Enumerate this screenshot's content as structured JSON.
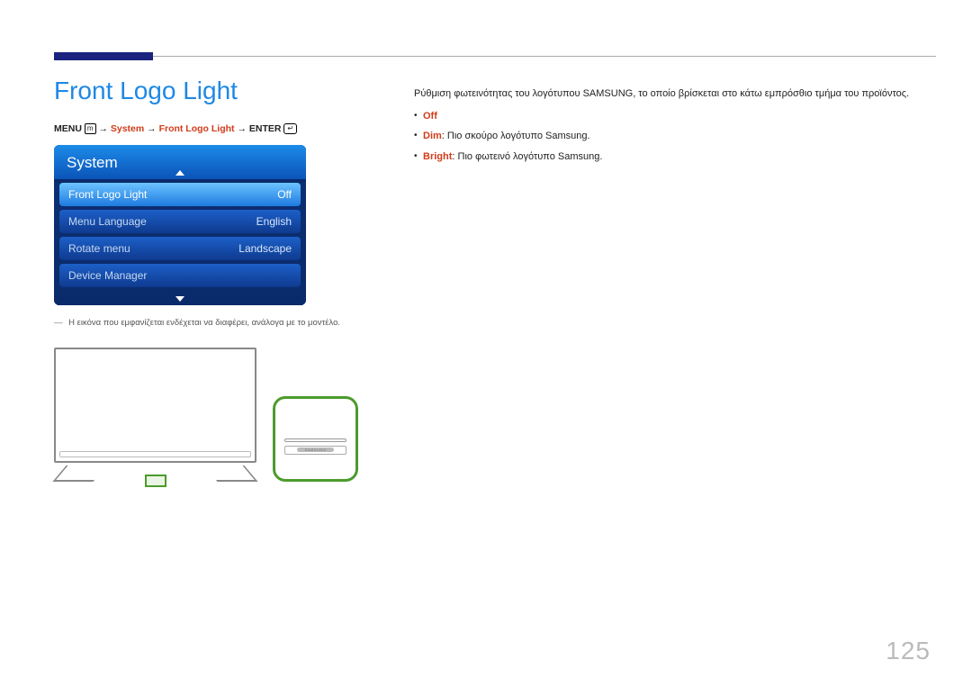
{
  "title": "Front Logo Light",
  "path": {
    "menu": "MENU",
    "arrow": "→",
    "seg1": "System",
    "seg2": "Front Logo Light",
    "enter": "ENTER"
  },
  "osd": {
    "header": "System",
    "rows": [
      {
        "label": "Front Logo Light",
        "value": "Off"
      },
      {
        "label": "Menu Language",
        "value": "English"
      },
      {
        "label": "Rotate menu",
        "value": "Landscape"
      },
      {
        "label": "Device Manager",
        "value": ""
      }
    ]
  },
  "note": "Η εικόνα που εμφανίζεται ενδέχεται να διαφέρει, ανάλογα με το μοντέλο.",
  "right": {
    "intro": "Ρύθμιση φωτεινότητας του λογότυπου SAMSUNG, το οποίο βρίσκεται στο κάτω εμπρόσθιο τμήμα του προϊόντος.",
    "opt_off": "Off",
    "opt_dim_label": "Dim",
    "opt_dim_text": ": Πιο σκούρο λογότυπο Samsung.",
    "opt_bright_label": "Bright",
    "opt_bright_text": ": Πιο φωτεινό λογότυπο Samsung."
  },
  "zoom_logo": "SAMSUNG",
  "page_number": "125"
}
